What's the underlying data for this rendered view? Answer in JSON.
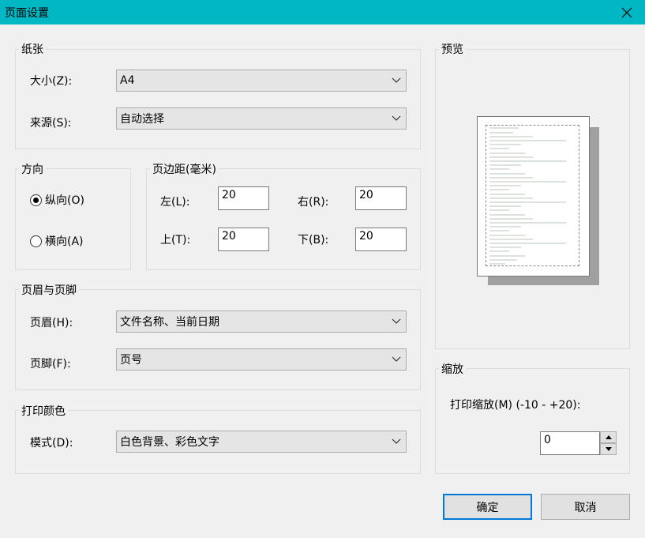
{
  "window": {
    "title": "页面设置"
  },
  "paper": {
    "group_label": "纸张",
    "size_label": "大小(Z):",
    "size_value": "A4",
    "source_label": "来源(S):",
    "source_value": "自动选择"
  },
  "orientation": {
    "group_label": "方向",
    "portrait_label": "纵向(O)",
    "landscape_label": "横向(A)",
    "selected": "portrait"
  },
  "margins": {
    "group_label": "页边距(毫米)",
    "left_label": "左(L):",
    "left_value": "20",
    "right_label": "右(R):",
    "right_value": "20",
    "top_label": "上(T):",
    "top_value": "20",
    "bottom_label": "下(B):",
    "bottom_value": "20"
  },
  "header_footer": {
    "group_label": "页眉与页脚",
    "header_label": "页眉(H):",
    "header_value": "文件名称、当前日期",
    "footer_label": "页脚(F):",
    "footer_value": "页号"
  },
  "print_color": {
    "group_label": "打印颜色",
    "mode_label": "模式(D):",
    "mode_value": "白色背景、彩色文字"
  },
  "preview": {
    "group_label": "预览"
  },
  "scale": {
    "group_label": "缩放",
    "label": "打印缩放(M) (-10 - +20):",
    "value": "0"
  },
  "buttons": {
    "ok": "确定",
    "cancel": "取消"
  },
  "colors": {
    "titlebar": "#00b7c3",
    "default_button_border": "#0078d7"
  }
}
